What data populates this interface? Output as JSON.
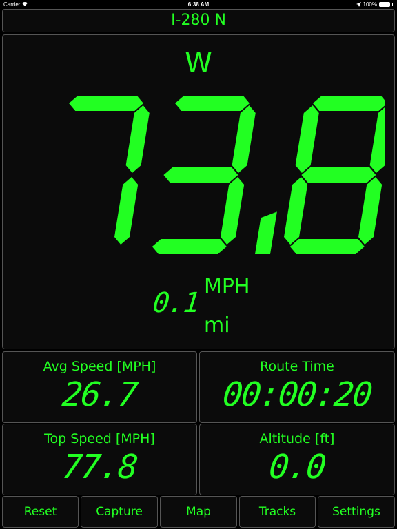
{
  "status_bar": {
    "carrier": "Carrier",
    "time": "6:38 AM",
    "battery": "100%",
    "icons": [
      "wifi-icon",
      "location-arrow-icon",
      "battery-icon"
    ]
  },
  "road": "I-280 N",
  "heading": "W",
  "speed": "73.8",
  "speed_unit": "MPH",
  "distance": "0.1",
  "distance_unit": "mi",
  "stats": {
    "avg_speed": {
      "label": "Avg Speed [MPH]",
      "value": "26.7"
    },
    "route_time": {
      "label": "Route Time",
      "value": "00:00:20"
    },
    "top_speed": {
      "label": "Top Speed [MPH]",
      "value": "77.8"
    },
    "altitude": {
      "label": "Altitude [ft]",
      "value": "0.0"
    }
  },
  "buttons": {
    "reset": "Reset",
    "capture": "Capture",
    "map": "Map",
    "tracks": "Tracks",
    "settings": "Settings"
  },
  "colors": {
    "accent": "#22ff22",
    "background": "#000000",
    "panel": "#0b0b0b",
    "border": "#555555"
  }
}
